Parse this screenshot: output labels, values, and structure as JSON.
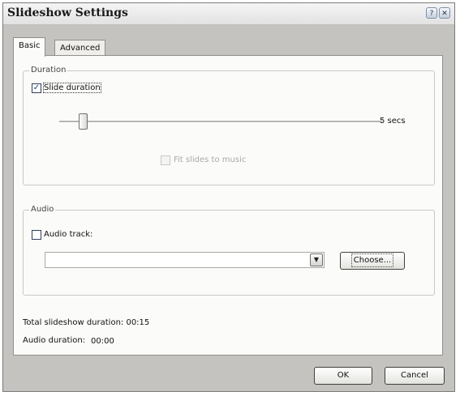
{
  "window": {
    "title": "Slideshow Settings"
  },
  "titlebar_buttons": {
    "help": "?",
    "close": "✕"
  },
  "tabs": [
    {
      "label": "Basic"
    },
    {
      "label": "Advanced"
    }
  ],
  "duration": {
    "group_label": "Duration",
    "slide_duration_label": "Slide duration",
    "slide_duration_checked": true,
    "slider_value_label": "5 secs",
    "fit_to_music_label": "Fit slides to music",
    "fit_to_music_checked": false,
    "fit_to_music_enabled": false
  },
  "audio": {
    "group_label": "Audio",
    "audio_track_label": "Audio track:",
    "audio_track_checked": false,
    "track_value": "",
    "choose_label": "Choose..."
  },
  "summary": {
    "total_label": "Total slideshow duration: 00:15",
    "audio_label": "Audio duration:",
    "audio_value": "00:00"
  },
  "footer": {
    "ok_label": "OK",
    "cancel_label": "Cancel"
  },
  "icons": {
    "check": "✓",
    "dropdown": "▼"
  }
}
